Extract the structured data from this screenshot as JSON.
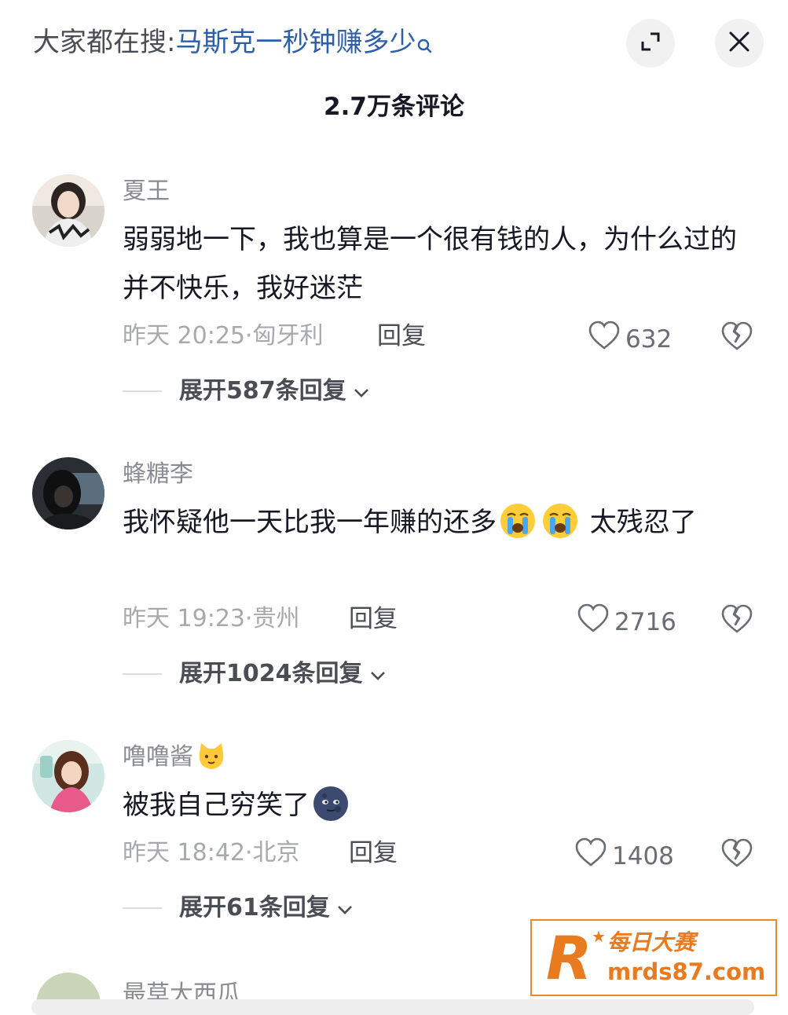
{
  "header": {
    "search_prefix": "大家都在搜:",
    "search_term": "马斯克一秒钟赚多少",
    "comment_count": "2.7万条评论"
  },
  "comments": [
    {
      "username": "夏王",
      "content_parts": [
        "弱弱地一下，我也算是一个很有钱的人，为什么过的并不快乐，我好迷茫"
      ],
      "time": "昨天 20:25",
      "location": "匈牙利",
      "reply_label": "回复",
      "likes": "632",
      "expand_label": "展开587条回复"
    },
    {
      "username": "蜂糖李",
      "content_before": "我怀疑他一天比我一年赚的还多",
      "content_after": " 太残忍了",
      "emoji": [
        "crying-face",
        "crying-face"
      ],
      "time": "昨天 19:23",
      "location": "贵州",
      "reply_label": "回复",
      "likes": "2716",
      "expand_label": "展开1024条回复"
    },
    {
      "username": "噜噜酱",
      "username_emoji": "cat-face",
      "content_before": "被我自己穷笑了",
      "emoji": [
        "new-moon-face"
      ],
      "time": "昨天 18:42",
      "location": "北京",
      "reply_label": "回复",
      "likes": "1408",
      "expand_label": "展开61条回复"
    }
  ],
  "partial_comment": {
    "username": "最草大西瓜"
  },
  "watermark": {
    "logo": "R",
    "brand": "每日大赛",
    "site": "mrds87.com"
  },
  "colors": {
    "link_blue": "#2c5fa8",
    "meta_grey": "#a8a9ad",
    "watermark_orange": "#e87a1f"
  }
}
